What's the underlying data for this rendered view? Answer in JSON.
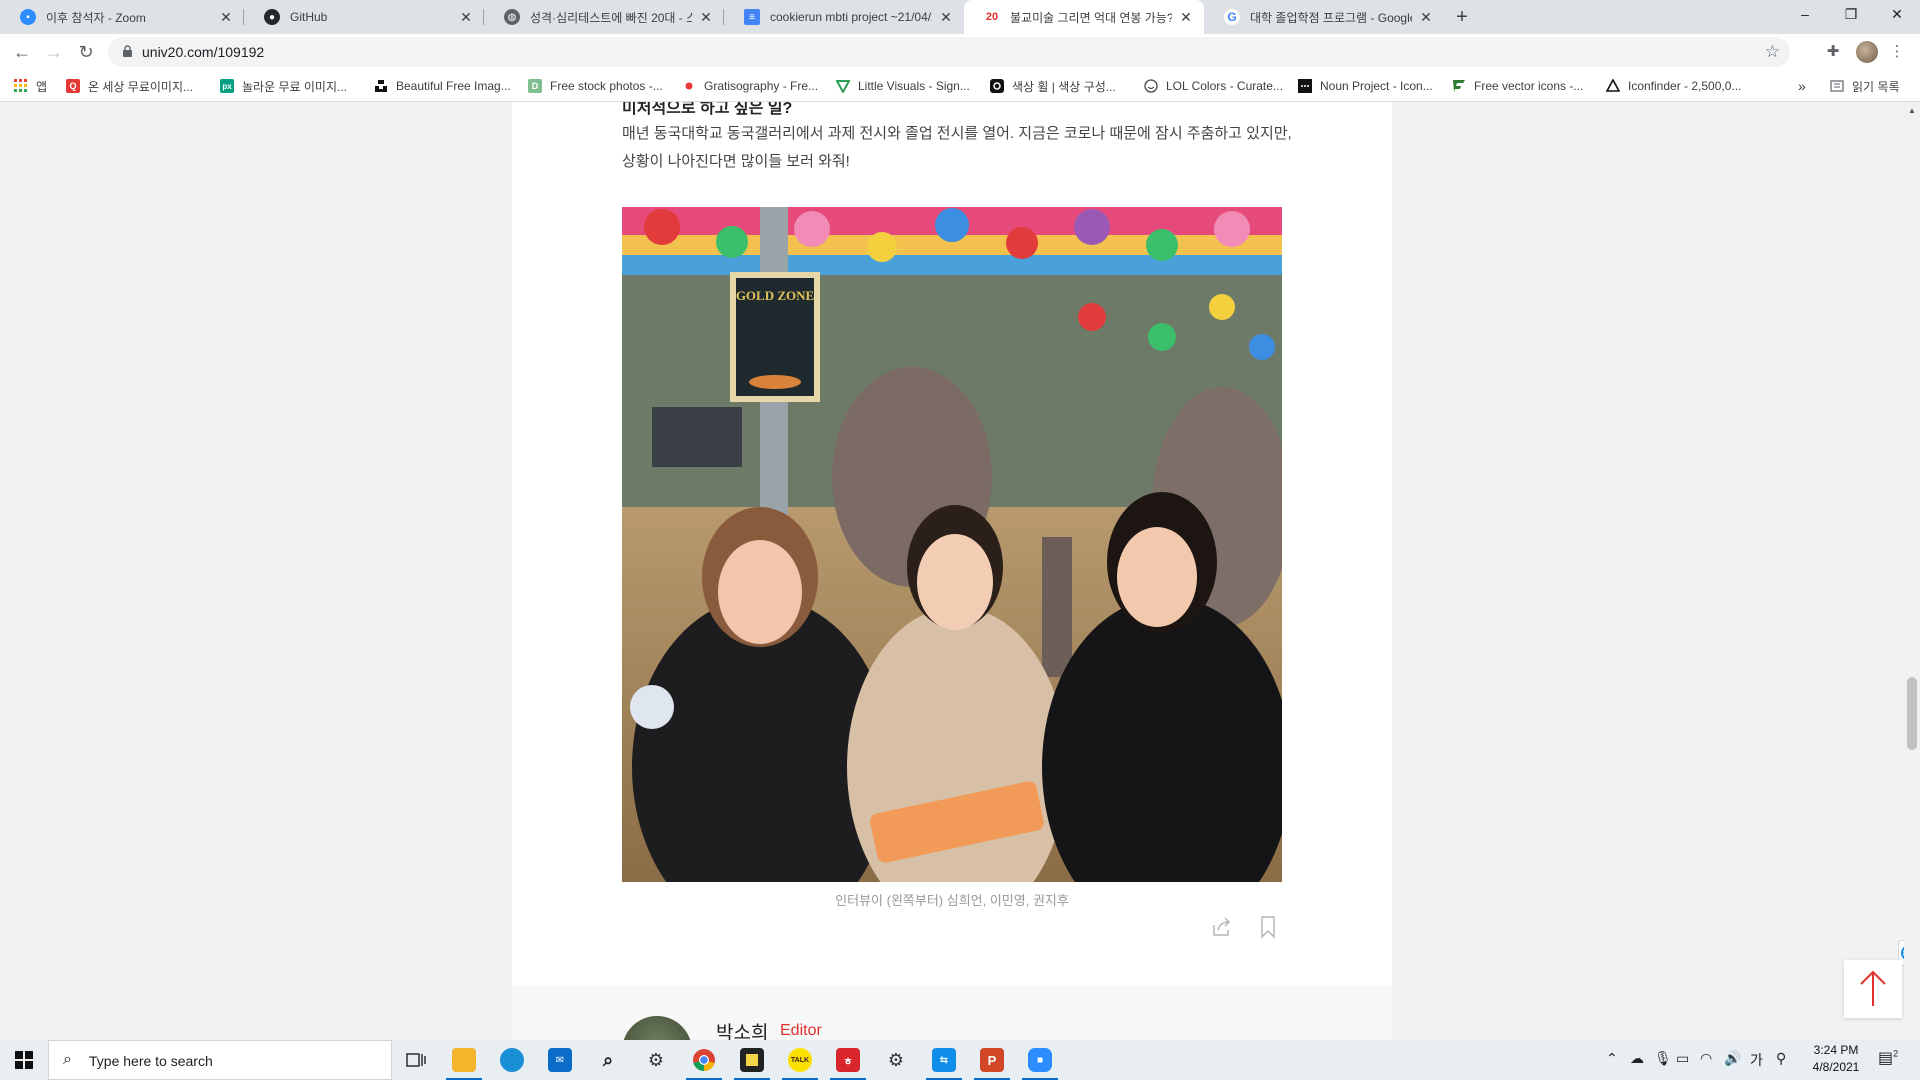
{
  "browser": {
    "tabs": [
      {
        "title": "이후 참석자 - Zoom",
        "icon": "zoom-icon",
        "color": "#2d8cff"
      },
      {
        "title": "GitHub",
        "icon": "github-icon",
        "color": "#24292e"
      },
      {
        "title": "성격·심리테스트에 빠진 20대 - 스",
        "icon": "globe-icon",
        "color": "#5f6368"
      },
      {
        "title": "cookierun mbti project ~21/04/2",
        "icon": "docs-icon",
        "color": "#4285f4"
      },
      {
        "title": "불교미술 그리면 억대 연봉 가능?",
        "icon": "univ20-icon",
        "color": "#e0312f",
        "active": true
      },
      {
        "title": "대학 졸업학점 프로그램 - Google",
        "icon": "google-icon",
        "color": "#4285f4"
      }
    ],
    "new_tab": "+",
    "window_controls": {
      "minimize": "–",
      "maximize": "❐",
      "close": "✕"
    },
    "url": "univ20.com/109192",
    "bookmarks": [
      {
        "label": "앱",
        "icon": "apps-grid-icon",
        "color": "#ea4335"
      },
      {
        "label": "온 세상 무료이미지...",
        "icon": "q-logo-icon",
        "color": "#e53935",
        "glyph": "Q"
      },
      {
        "label": "놀라운 무료 이미지...",
        "icon": "pexels-icon",
        "color": "#05a081",
        "glyph": "px"
      },
      {
        "label": "Beautiful Free Imag...",
        "icon": "unsplash-icon",
        "color": "#111111"
      },
      {
        "label": "Free stock photos -...",
        "icon": "stock-photo-icon",
        "color": "#7fbf8f",
        "glyph": "D"
      },
      {
        "label": "Gratisography - Fre...",
        "icon": "gratisography-icon",
        "color": "#e53935"
      },
      {
        "label": "Little Visuals - Sign...",
        "icon": "little-visuals-icon",
        "color": "#2e9d5b"
      },
      {
        "label": "색상 휠 | 색상 구성...",
        "icon": "adobe-color-icon",
        "color": "#111111"
      },
      {
        "label": "LOL Colors - Curate...",
        "icon": "lol-colors-icon",
        "color": "#444444"
      },
      {
        "label": "Noun Project - Icon...",
        "icon": "noun-project-icon",
        "color": "#111111"
      },
      {
        "label": "Free vector icons -...",
        "icon": "flaticon-icon",
        "color": "#2e7d32"
      },
      {
        "label": "Iconfinder - 2,500,0...",
        "icon": "iconfinder-icon",
        "color": "#111111"
      }
    ],
    "bookmarks_more": "»",
    "reading_list": "읽기 목록"
  },
  "article": {
    "heading_partial": "미처적으로 하고 싶은 일?",
    "paragraph": "매년 동국대학교 동국갤러리에서 과제 전시와 졸업 전시를 열어. 지금은 코로나 때문에 잠시 주춤하고 있지만, 상황이 나아진다면 많이들 보러 와줘!",
    "photo_sign": "GOLD ZONE",
    "caption": "인터뷰이 (왼쪽부터) 심희언, 이민영, 권지후",
    "author_name": "박소희",
    "author_role": "Editor"
  },
  "taskbar": {
    "search_placeholder": "Type here to search",
    "apps": [
      {
        "name": "task-view",
        "color": "#222222"
      },
      {
        "name": "file-explorer",
        "color": "#f3b52b"
      },
      {
        "name": "edge",
        "color": "#1b8fd6"
      },
      {
        "name": "mail",
        "color": "#0a6cc7"
      },
      {
        "name": "search-app",
        "color": "#222222"
      },
      {
        "name": "settings",
        "color": "#333333"
      },
      {
        "name": "chrome",
        "color": "#1a73e8"
      },
      {
        "name": "sticky-notes",
        "color": "#222222"
      },
      {
        "name": "kakaotalk",
        "color": "#f9e000",
        "glyph": "TALK"
      },
      {
        "name": "hancom",
        "color": "#d9262a"
      },
      {
        "name": "gear-app",
        "color": "#333333"
      },
      {
        "name": "teamviewer",
        "color": "#0e8ee9"
      },
      {
        "name": "powerpoint",
        "color": "#d24726",
        "glyph": "P"
      },
      {
        "name": "zoom",
        "color": "#2d8cff"
      }
    ],
    "ime": "가",
    "time": "3:24 PM",
    "date": "4/8/2021",
    "notifications": "2"
  }
}
